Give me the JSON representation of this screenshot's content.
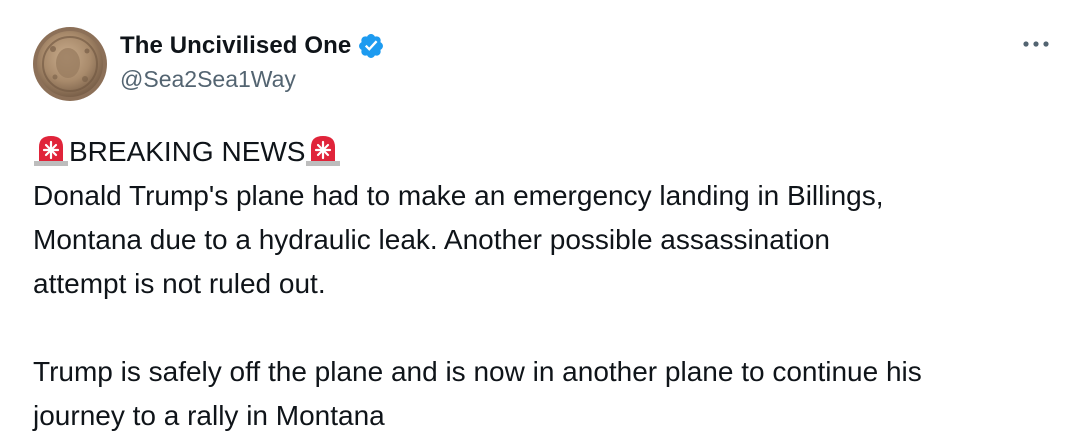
{
  "author": {
    "display_name": "The Uncivilised One",
    "handle": "@Sea2Sea1Way",
    "verified": true,
    "avatar_icon": "coin-avatar",
    "verified_icon": "verified-badge-icon",
    "verified_color": "#1d9bf0"
  },
  "menu": {
    "icon": "more-options-icon"
  },
  "tweet": {
    "headline_icon": "rotating-light-emoji",
    "headline": "BREAKING NEWS",
    "paragraph1_lines": [
      "Donald Trump's plane had to make an emergency landing in Billings,",
      "Montana due to a hydraulic leak. Another possible assassination",
      "attempt is not ruled out."
    ],
    "paragraph2_lines": [
      "Trump is safely off the plane and is now in another plane to continue his",
      "journey to a rally in Montana"
    ]
  },
  "colors": {
    "text": "#0f1419",
    "secondary_text": "#536471",
    "siren_red": "#e0243a"
  }
}
